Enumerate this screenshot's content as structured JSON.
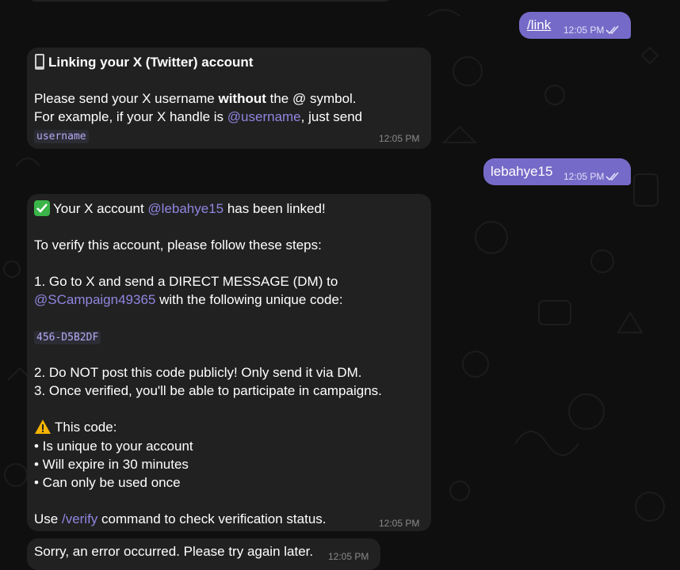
{
  "colors": {
    "background": "#0f0f0f",
    "incoming_bubble": "#212121",
    "outgoing_bubble": "#766ac8",
    "mention": "#8f86e0",
    "timestamp": "#8a8a8a"
  },
  "messages": {
    "m1": {
      "text": "/link",
      "time": "12:05 PM"
    },
    "m2": {
      "icon": "mobile-phone-icon",
      "title": "Linking your X (Twitter) account",
      "l1_pre": "Please send your X username ",
      "l1_bold": "without",
      "l1_post": " the @ symbol.",
      "l2_pre": "For example, if your X handle is ",
      "l2_mention": "@username",
      "l2_post": ", just send",
      "code": "username",
      "time": "12:05 PM"
    },
    "m3": {
      "text": "lebahye15",
      "time": "12:05 PM"
    },
    "m4": {
      "check_icon": "check-mark-icon",
      "l1_pre": "Your X account ",
      "l1_mention": "@lebahye15",
      "l1_post": " has been linked!",
      "l2": "To verify this account, please follow these steps:",
      "l3": "1. Go to X and send a DIRECT MESSAGE (DM) to",
      "l4_mention": "@SCampaign49365",
      "l4_post": " with the following unique code:",
      "code": "456-D5B2DF",
      "l5": "2. Do NOT post this code publicly! Only send it via DM.",
      "l6": "3. Once verified, you'll be able to participate in campaigns.",
      "warning_icon": "warning-icon",
      "l7": "This code:",
      "l8": "• Is unique to your account",
      "l9": "• Will expire in 30 minutes",
      "l10": "• Can only be used once",
      "l11_pre": "Use ",
      "l11_cmd": "/verify",
      "l11_post": " command to check verification status.",
      "time": "12:05 PM"
    },
    "m5": {
      "text": "Sorry, an error occurred. Please try again later.",
      "time": "12:05 PM"
    }
  }
}
